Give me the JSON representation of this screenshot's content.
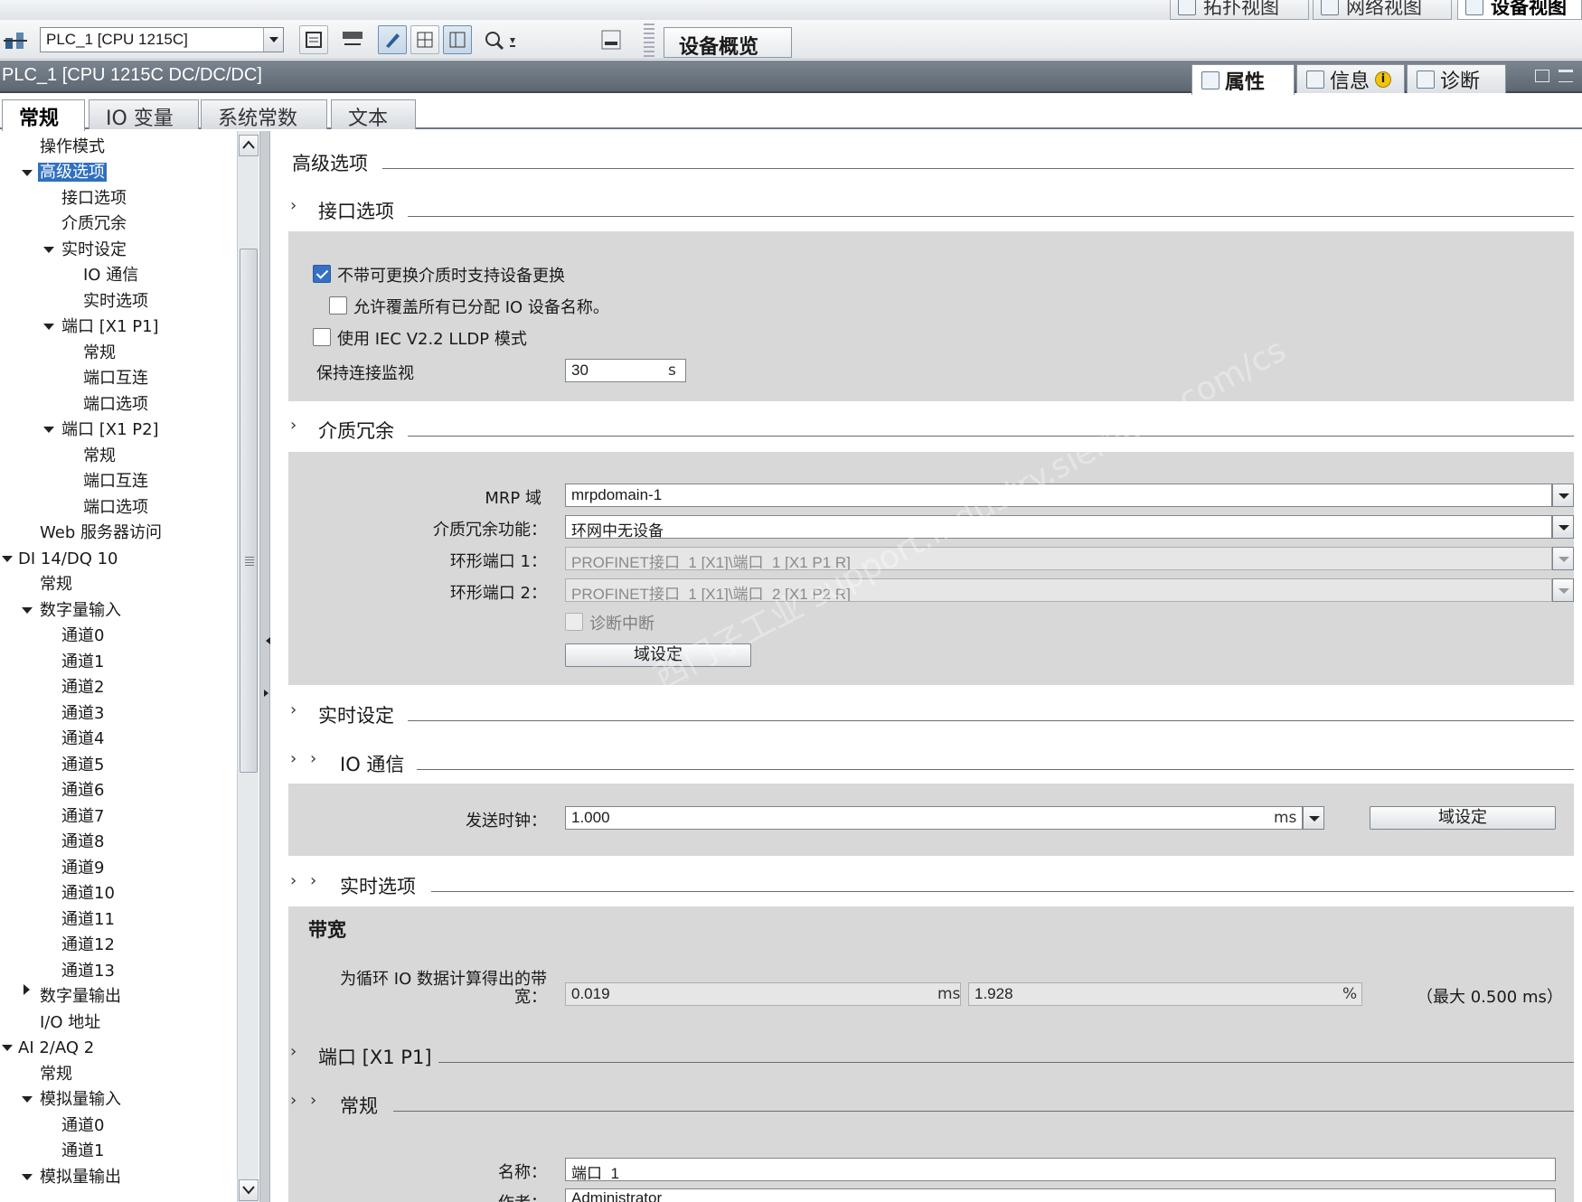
{
  "views": {
    "topology": "拓扑视图",
    "network": "网络视图",
    "device": "设备视图"
  },
  "toolbar": {
    "device_select": "PLC_1 [CPU 1215C]",
    "overview_tab": "设备概览"
  },
  "titlebar": {
    "title": "PLC_1 [CPU 1215C DC/DC/DC]"
  },
  "inspector_tabs": {
    "properties": "属性",
    "info": "信息",
    "diagnostics": "诊断"
  },
  "tabs": [
    "常规",
    "IO 变量",
    "系统常数",
    "文本"
  ],
  "tree": [
    "操作模式",
    "高级选项",
    "接口选项",
    "介质冗余",
    "实时设定",
    "IO 通信",
    "实时选项",
    "端口 [X1 P1]",
    "常规",
    "端口互连",
    "端口选项",
    "端口 [X1 P2]",
    "常规",
    "端口互连",
    "端口选项",
    "Web 服务器访问",
    "DI 14/DQ 10",
    "常规",
    "数字量输入",
    "通道0",
    "通道1",
    "通道2",
    "通道3",
    "通道4",
    "通道5",
    "通道6",
    "通道7",
    "通道8",
    "通道9",
    "通道10",
    "通道11",
    "通道12",
    "通道13",
    "数字量输出",
    "I/O 地址",
    "AI 2/AQ 2",
    "常规",
    "模拟量输入",
    "通道0",
    "通道1",
    "模拟量输出"
  ],
  "content": {
    "advanced_title": "高级选项",
    "interface_options": {
      "title": "接口选项",
      "cb1": "不带可更换介质时支持设备更换",
      "cb2": "允许覆盖所有已分配 IO 设备名称。",
      "cb3": "使用 IEC V2.2 LLDP 模式",
      "keepalive_label": "保持连接监视",
      "keepalive_value": "30",
      "keepalive_unit": "s"
    },
    "media_redundancy": {
      "title": "介质冗余",
      "mrp_label": "MRP 域",
      "mrp_value": "mrpdomain-1",
      "func_label": "介质冗余功能：",
      "func_value": "环网中无设备",
      "ring1_label": "环形端口 1：",
      "ring1_value": "PROFINET接口_1 [X1]\\端口_1 [X1 P1 R]",
      "ring2_label": "环形端口 2：",
      "ring2_value": "PROFINET接口_1 [X1]\\端口_2 [X1 P2 R]",
      "diag_label": "诊断中断",
      "domain_btn": "域设定"
    },
    "realtime": {
      "title": "实时设定"
    },
    "io_comm": {
      "title": "IO 通信",
      "send_clock_label": "发送时钟：",
      "send_clock_value": "1.000",
      "send_clock_unit": "ms",
      "domain_btn": "域设定"
    },
    "rt_options": {
      "title": "实时选项",
      "bandwidth_title": "带宽",
      "bw_label_1": "为循环 IO 数据计算得出的带",
      "bw_label_2": "宽：",
      "bw_ms_value": "0.019",
      "bw_ms_unit": "ms",
      "bw_pct_value": "1.928",
      "bw_pct_unit": "%",
      "bw_max": "（最大 0.500 ms）"
    },
    "port_p1": {
      "title": "端口 [X1 P1]",
      "general_title": "常规",
      "name_label": "名称：",
      "name_value": "端口_1",
      "author_label": "作者：",
      "author_value": "Administrator"
    },
    "watermark": "西门子工业 support.industry.siemens.com/cs"
  }
}
